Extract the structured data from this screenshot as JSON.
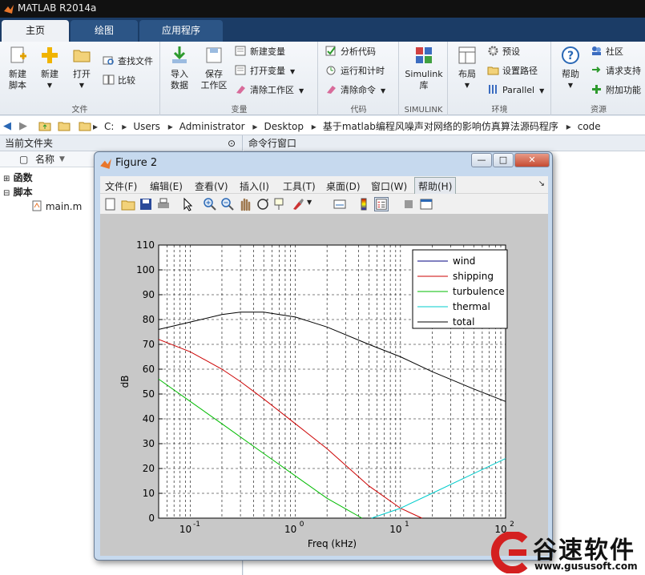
{
  "window": {
    "title": "MATLAB R2014a"
  },
  "tabs": [
    {
      "label": "主页"
    },
    {
      "label": "绘图"
    },
    {
      "label": "应用程序"
    }
  ],
  "ribbon": {
    "file": {
      "label": "文件",
      "new_script": "新建\n脚本",
      "new": "新建",
      "open": "打开",
      "find_files": "查找文件",
      "compare": "比较"
    },
    "variable": {
      "label": "变量",
      "import": "导入\n数据",
      "save": "保存\n工作区",
      "new_var": "新建变量",
      "open_var": "打开变量",
      "clear_ws": "清除工作区"
    },
    "code": {
      "label": "代码",
      "analyze": "分析代码",
      "run_time": "运行和计时",
      "clear_cmd": "清除命令"
    },
    "simulink": {
      "label": "SIMULINK",
      "lib": "Simulink\n库"
    },
    "env": {
      "label": "环境",
      "layout": "布局",
      "prefs": "预设",
      "set_path": "设置路径",
      "parallel": "Parallel"
    },
    "resources": {
      "label": "资源",
      "help": "帮助",
      "community": "社区",
      "request": "请求支持",
      "addons": "附加功能"
    }
  },
  "address": {
    "crumbs": [
      "C:",
      "Users",
      "Administrator",
      "Desktop",
      "基于matlab编程风噪声对网络的影响仿真算法源码程序",
      "code"
    ]
  },
  "current_folder": {
    "title": "当前文件夹",
    "col_name": "名称",
    "tree": [
      {
        "label": "函数"
      },
      {
        "label": "脚本"
      }
    ],
    "file": "main.m"
  },
  "command_window": {
    "title": "命令行窗口"
  },
  "figure": {
    "title": "Figure 2",
    "menu": [
      "文件(F)",
      "编辑(E)",
      "查看(V)",
      "插入(I)",
      "工具(T)",
      "桌面(D)",
      "窗口(W)",
      "帮助(H)"
    ],
    "min": "—",
    "max": "□",
    "close": "✕"
  },
  "chart_data": {
    "type": "line",
    "xlabel": "Freq (kHz)",
    "ylabel": "dB",
    "xscale": "log",
    "xlim": [
      0.05,
      100
    ],
    "ylim": [
      0,
      110
    ],
    "yticks": [
      0,
      10,
      20,
      30,
      40,
      50,
      60,
      70,
      80,
      90,
      100,
      110
    ],
    "xtick_labels": [
      {
        "base": "10",
        "exp": "-1",
        "v": 0.1
      },
      {
        "base": "10",
        "exp": "0",
        "v": 1
      },
      {
        "base": "10",
        "exp": "1",
        "v": 10
      },
      {
        "base": "10",
        "exp": "2",
        "v": 100
      }
    ],
    "grid": true,
    "legend": "top-right",
    "series": [
      {
        "name": "wind",
        "color": "#000080",
        "x": [],
        "y": []
      },
      {
        "name": "shipping",
        "color": "#cc0000",
        "x": [
          0.05,
          0.1,
          0.2,
          0.3,
          0.5,
          1,
          2,
          5,
          10,
          16
        ],
        "y": [
          72,
          67,
          60,
          55,
          48,
          38,
          28,
          13,
          4,
          0
        ]
      },
      {
        "name": "turbulence",
        "color": "#00bb00",
        "x": [
          0.05,
          0.1,
          0.2,
          0.5,
          1,
          2,
          4.3
        ],
        "y": [
          56,
          47,
          38,
          26,
          17,
          8,
          0
        ]
      },
      {
        "name": "thermal",
        "color": "#00cccc",
        "x": [
          5.3,
          10,
          20,
          50,
          100
        ],
        "y": [
          0,
          4,
          10,
          18,
          24
        ]
      },
      {
        "name": "total",
        "color": "#000000",
        "x": [
          0.05,
          0.1,
          0.2,
          0.3,
          0.5,
          1,
          2,
          5,
          10,
          20,
          50,
          100
        ],
        "y": [
          76,
          79,
          82,
          83,
          83,
          81,
          77,
          70,
          65,
          59,
          52,
          47
        ]
      }
    ]
  },
  "watermark": {
    "text": "谷速软件",
    "url": "www.gususoft.com"
  }
}
